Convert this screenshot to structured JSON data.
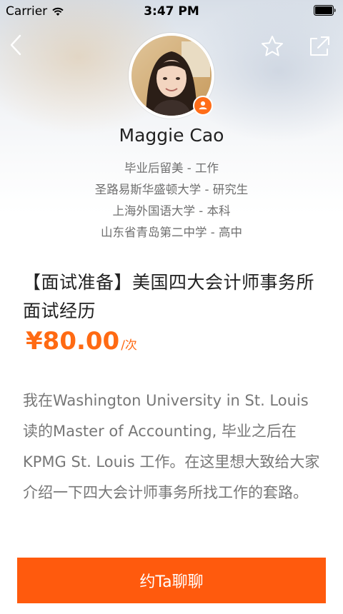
{
  "status_bar": {
    "carrier": "Carrier",
    "time": "3:47 PM"
  },
  "nav": {
    "back_icon": "chevron-left-icon",
    "favorite_icon": "star-outline-icon",
    "share_icon": "share-external-icon"
  },
  "profile": {
    "name": "Maggie Cao",
    "badge_icon": "person-badge-icon",
    "education": [
      "毕业后留美 - 工作",
      "圣路易斯华盛顿大学 - 研究生",
      "上海外国语大学 - 本科",
      "山东省青岛第二中学 - 高中"
    ]
  },
  "service": {
    "title": "【面试准备】美国四大会计师事务所面试经历",
    "price": "¥80.00",
    "price_unit": "/次",
    "description": "我在Washington University in St. Louis 读的Master of Accounting, 毕业之后在KPMG St. Louis 工作。在这里想大致给大家介绍一下四大会计师事务所找工作的套路。"
  },
  "cta": {
    "label": "约Ta聊聊"
  },
  "colors": {
    "accent": "#ff6a13",
    "button": "#ff5a0d",
    "text_primary": "#222222",
    "text_secondary": "#777777"
  }
}
